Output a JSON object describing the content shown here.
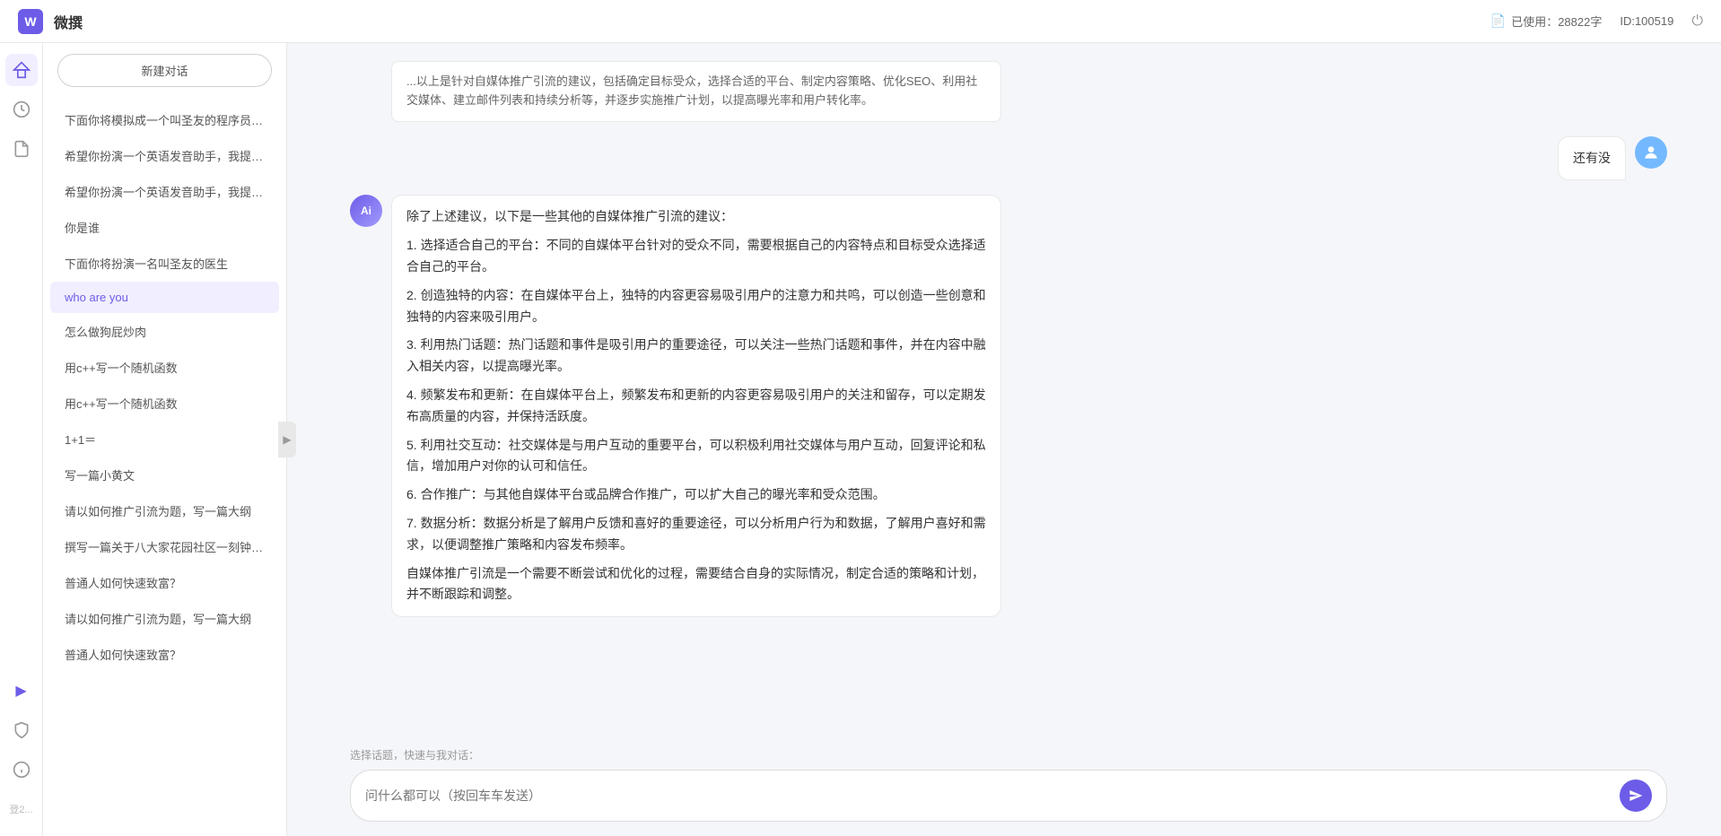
{
  "topbar": {
    "logo_label": "W",
    "title": "微撰",
    "usage_label": "已使用：28822字",
    "id_label": "ID:100519",
    "doc_icon": "📄"
  },
  "sidebar_icons": [
    {
      "name": "home-icon",
      "icon": "⬡",
      "active": true
    },
    {
      "name": "clock-icon",
      "icon": "🕐",
      "active": false
    },
    {
      "name": "file-icon",
      "icon": "📝",
      "active": false
    },
    {
      "name": "arrow-icon",
      "icon": "▶",
      "active": false
    },
    {
      "name": "shield-icon",
      "icon": "🛡",
      "active": false
    },
    {
      "name": "info-icon",
      "icon": "ℹ",
      "active": false
    }
  ],
  "conversations": {
    "new_btn_label": "新建对话",
    "items": [
      {
        "id": 1,
        "text": "下面你将模拟成一个叫圣友的程序员，我说...",
        "active": false
      },
      {
        "id": 2,
        "text": "希望你扮演一个英语发音助手，我提供给你...",
        "active": false
      },
      {
        "id": 3,
        "text": "希望你扮演一个英语发音助手，我提供给你...",
        "active": false
      },
      {
        "id": 4,
        "text": "你是谁",
        "active": false
      },
      {
        "id": 5,
        "text": "下面你将扮演一名叫圣友的医生",
        "active": false
      },
      {
        "id": 6,
        "text": "who are you",
        "active": true
      },
      {
        "id": 7,
        "text": "怎么做狗屁炒肉",
        "active": false
      },
      {
        "id": 8,
        "text": "用c++写一个随机函数",
        "active": false
      },
      {
        "id": 9,
        "text": "用c++写一个随机函数",
        "active": false
      },
      {
        "id": 10,
        "text": "1+1＝",
        "active": false
      },
      {
        "id": 11,
        "text": "写一篇小黄文",
        "active": false
      },
      {
        "id": 12,
        "text": "请以如何推广引流为题，写一篇大纲",
        "active": false
      },
      {
        "id": 13,
        "text": "撰写一篇关于八大家花园社区一刻钟便民生...",
        "active": false
      },
      {
        "id": 14,
        "text": "普通人如何快速致富？",
        "active": false
      },
      {
        "id": 15,
        "text": "请以如何推广引流为题，写一篇大纲",
        "active": false
      },
      {
        "id": 16,
        "text": "普通人如何快速致富？",
        "active": false
      }
    ]
  },
  "chat": {
    "truncated_msg": "...以上是针对自媒体推广引流的建议，包括确定目标受众，选择合适的平台、制定内容策略、优化SEO、利用社交媒体、建立邮件列表和持续分析等，并逐步实施推广计划，以提高曝光率和用户转化率。",
    "messages": [
      {
        "role": "user",
        "avatar_text": "用",
        "text": "还有没"
      },
      {
        "role": "assistant",
        "avatar_text": "Ai",
        "text": "除了上述建议，以下是一些其他的自媒体推广引流的建议：\n\n1. 选择适合自己的平台：不同的自媒体平台针对的受众不同，需要根据自己的内容特点和目标受众选择适合自己的平台。\n\n2. 创造独特的内容：在自媒体平台上，独特的内容更容易吸引用户的注意力和共鸣，可以创造一些创意和独特的内容来吸引用户。\n\n3. 利用热门话题：热门话题和事件是吸引用户的重要途径，可以关注一些热门话题和事件，并在内容中融入相关内容，以提高曝光率。\n\n4. 频繁发布和更新：在自媒体平台上，频繁发布和更新的内容更容易吸引用户的关注和留存，可以定期发布高质量的内容，并保持活跃度。\n\n5. 利用社交互动：社交媒体是与用户互动的重要平台，可以积极利用社交媒体与用户互动，回复评论和私信，增加用户对你的认可和信任。\n\n6. 合作推广：与其他自媒体平台或品牌合作推广，可以扩大自己的曝光率和受众范围。\n\n7. 数据分析：数据分析是了解用户反馈和喜好的重要途径，可以分析用户行为和数据，了解用户喜好和需求，以便调整推广策略和内容发布频率。\n\n自媒体推广引流是一个需要不断尝试和优化的过程，需要结合自身的实际情况，制定合适的策略和计划，并不断跟踪和调整。"
      }
    ],
    "quick_topics_label": "选择话题，快速与我对话：",
    "input_placeholder": "问什么都可以（按回车车发送）"
  }
}
